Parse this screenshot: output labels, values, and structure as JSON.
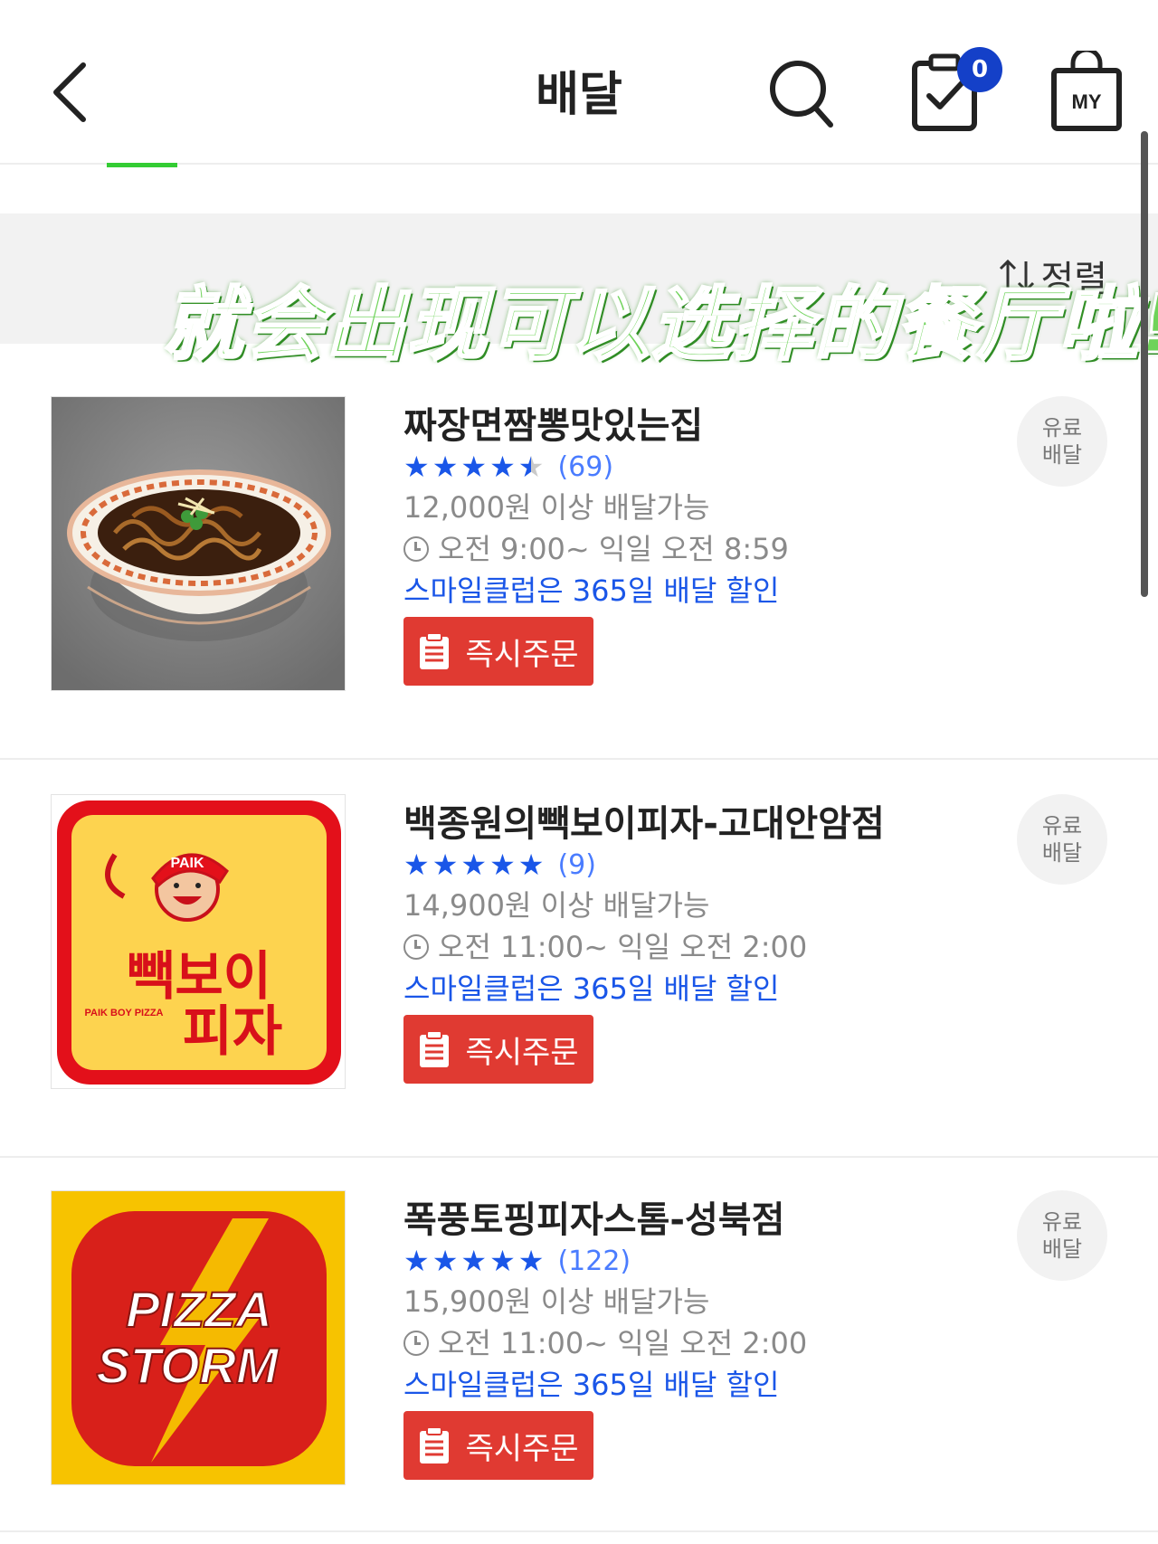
{
  "header": {
    "title": "배달",
    "cart_count": "0",
    "my_label": "MY"
  },
  "sort": {
    "label": "정렬"
  },
  "overlay_caption": "就会出现可以选择的餐厅啦!",
  "restaurants": [
    {
      "name": "짜장면짬뽕맛있는집",
      "rating": 4.5,
      "stars": [
        "★",
        "★",
        "★",
        "★",
        "★"
      ],
      "review_count": "(69)",
      "min_order": "12,000원 이상 배달가능",
      "hours": "오전 9:00~ 익일 오전 8:59",
      "promo": "스마일클럽은 365일 배달 할인",
      "order_label": "즉시주문",
      "delivery_type": [
        "유료",
        "배달"
      ]
    },
    {
      "name": "백종원의빽보이피자-고대안암점",
      "rating": 5,
      "stars": [
        "★",
        "★",
        "★",
        "★",
        "★"
      ],
      "review_count": "(9)",
      "min_order": "14,900원 이상 배달가능",
      "hours": "오전 11:00~ 익일 오전 2:00",
      "promo": "스마일클럽은 365일 배달 할인",
      "order_label": "즉시주문",
      "delivery_type": [
        "유료",
        "배달"
      ],
      "logo": {
        "brand_top": "PAIK",
        "brand_main_1": "빽보이",
        "brand_main_2": "피자",
        "brand_sub": "PAIK BOY PIZZA"
      }
    },
    {
      "name": "폭풍토핑피자스톰-성북점",
      "rating": 5,
      "stars": [
        "★",
        "★",
        "★",
        "★",
        "★"
      ],
      "review_count": "(122)",
      "min_order": "15,900원 이상 배달가능",
      "hours": "오전 11:00~ 익일 오전 2:00",
      "promo": "스마일클럽은 365일 배달 할인",
      "order_label": "즉시주문",
      "delivery_type": [
        "유료",
        "배달"
      ],
      "logo": {
        "line1": "PIZZA",
        "line2": "STORM"
      }
    }
  ],
  "colors": {
    "star": "#1a56e8",
    "promo": "#1a56e8",
    "order_button": "#e03a32",
    "badge": "#1440c8",
    "caption": "#6fd35a"
  }
}
